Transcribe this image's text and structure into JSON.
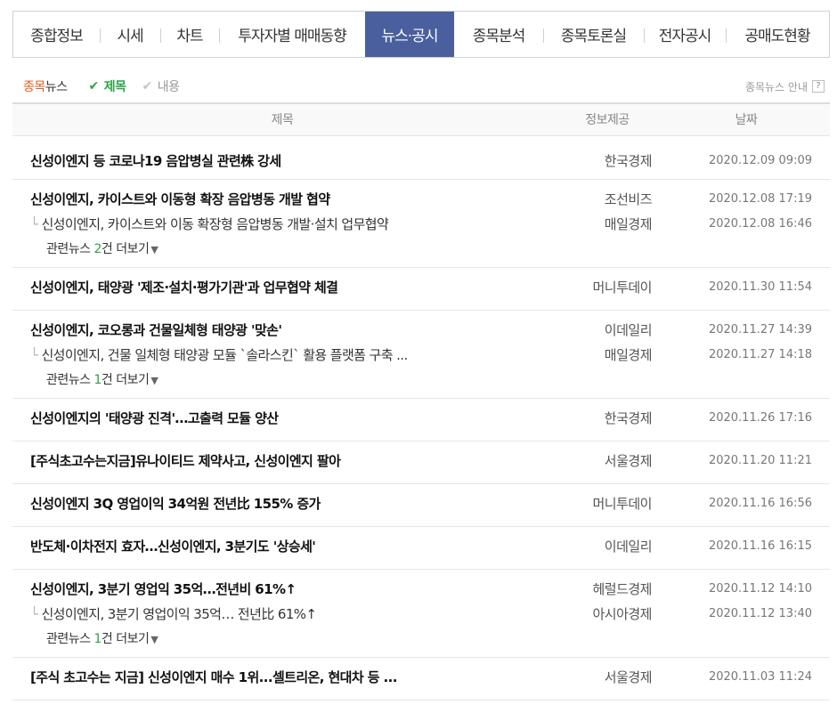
{
  "tabs": [
    {
      "label": "종합정보",
      "active": false
    },
    {
      "label": "시세",
      "active": false
    },
    {
      "label": "차트",
      "active": false
    },
    {
      "label": "투자자별 매매동향",
      "active": false
    },
    {
      "label": "뉴스·공시",
      "active": true
    },
    {
      "label": "종목분석",
      "active": false
    },
    {
      "label": "종목토론실",
      "active": false
    },
    {
      "label": "전자공시",
      "active": false
    },
    {
      "label": "공매도현황",
      "active": false
    }
  ],
  "subhead": {
    "title_hl": "종목",
    "title_rest": "뉴스",
    "filter_title": "제목",
    "filter_content": "내용",
    "guide": "종목뉴스 안내",
    "guide_icon": "?"
  },
  "table": {
    "headers": {
      "title": "제목",
      "source": "정보제공",
      "date": "날짜"
    },
    "groups": [
      {
        "title": "신성이엔지 등 코로나19 음압병실 관련株 강세",
        "source": "한국경제",
        "date": "2020.12.09 09:09",
        "related": []
      },
      {
        "title": "신성이엔지, 카이스트와 이동형 확장 음압병동 개발 협약",
        "source": "조선비즈",
        "date": "2020.12.08 17:19",
        "related": [
          {
            "title": "신성이엔지, 카이스트와 이동 확장형 음압병동 개발·설치 업무협약",
            "source": "매일경제",
            "date": "2020.12.08 16:46"
          }
        ],
        "more": {
          "prefix": "관련뉴스 ",
          "count": "2",
          "suffix": "건 더보기"
        }
      },
      {
        "title": "신성이엔지, 태양광 '제조·설치·평가기관'과 업무협약 체결",
        "source": "머니투데이",
        "date": "2020.11.30 11:54",
        "related": []
      },
      {
        "title": "신성이엔지, 코오롱과 건물일체형 태양광 '맞손'",
        "source": "이데일리",
        "date": "2020.11.27 14:39",
        "related": [
          {
            "title": "신성이엔지, 건물 일체형 태양광 모듈 `솔라스킨` 활용 플랫폼 구축 ...",
            "source": "매일경제",
            "date": "2020.11.27 14:18"
          }
        ],
        "more": {
          "prefix": "관련뉴스 ",
          "count": "1",
          "suffix": "건 더보기"
        }
      },
      {
        "title": "신성이엔지의 '태양광 진격'…고출력 모듈 양산",
        "source": "한국경제",
        "date": "2020.11.26 17:16",
        "related": []
      },
      {
        "title": "[주식초고수는지금]유나이티드 제약사고, 신성이엔지 팔아",
        "source": "서울경제",
        "date": "2020.11.20 11:21",
        "related": []
      },
      {
        "title": "신성이엔지 3Q 영업이익 34억원 전년比 155% 증가",
        "source": "머니투데이",
        "date": "2020.11.16 16:56",
        "related": []
      },
      {
        "title": "반도체·이차전지 효자…신성이엔지, 3분기도 '상승세'",
        "source": "이데일리",
        "date": "2020.11.16 16:15",
        "related": []
      },
      {
        "title": "신성이엔지, 3분기 영업익 35억…전년비 61%↑",
        "source": "헤럴드경제",
        "date": "2020.11.12 14:10",
        "related": [
          {
            "title": "신성이엔지, 3분기 영업이익 35억… 전년比 61%↑",
            "source": "아시아경제",
            "date": "2020.11.12 13:40"
          }
        ],
        "more": {
          "prefix": "관련뉴스 ",
          "count": "1",
          "suffix": "건 더보기"
        }
      },
      {
        "title": "[주식 초고수는 지금] 신성이엔지 매수 1위...셀트리온, 현대차 등 ...",
        "source": "서울경제",
        "date": "2020.11.03 11:24",
        "related": []
      }
    ]
  },
  "colors": {
    "active_tab": "#4a5f9e",
    "accent_green": "#2aa447",
    "accent_orange": "#e05a1a"
  },
  "icons": {
    "check": "check-icon",
    "chevron": "chevron-down-icon",
    "tree": "reply-branch-icon"
  }
}
